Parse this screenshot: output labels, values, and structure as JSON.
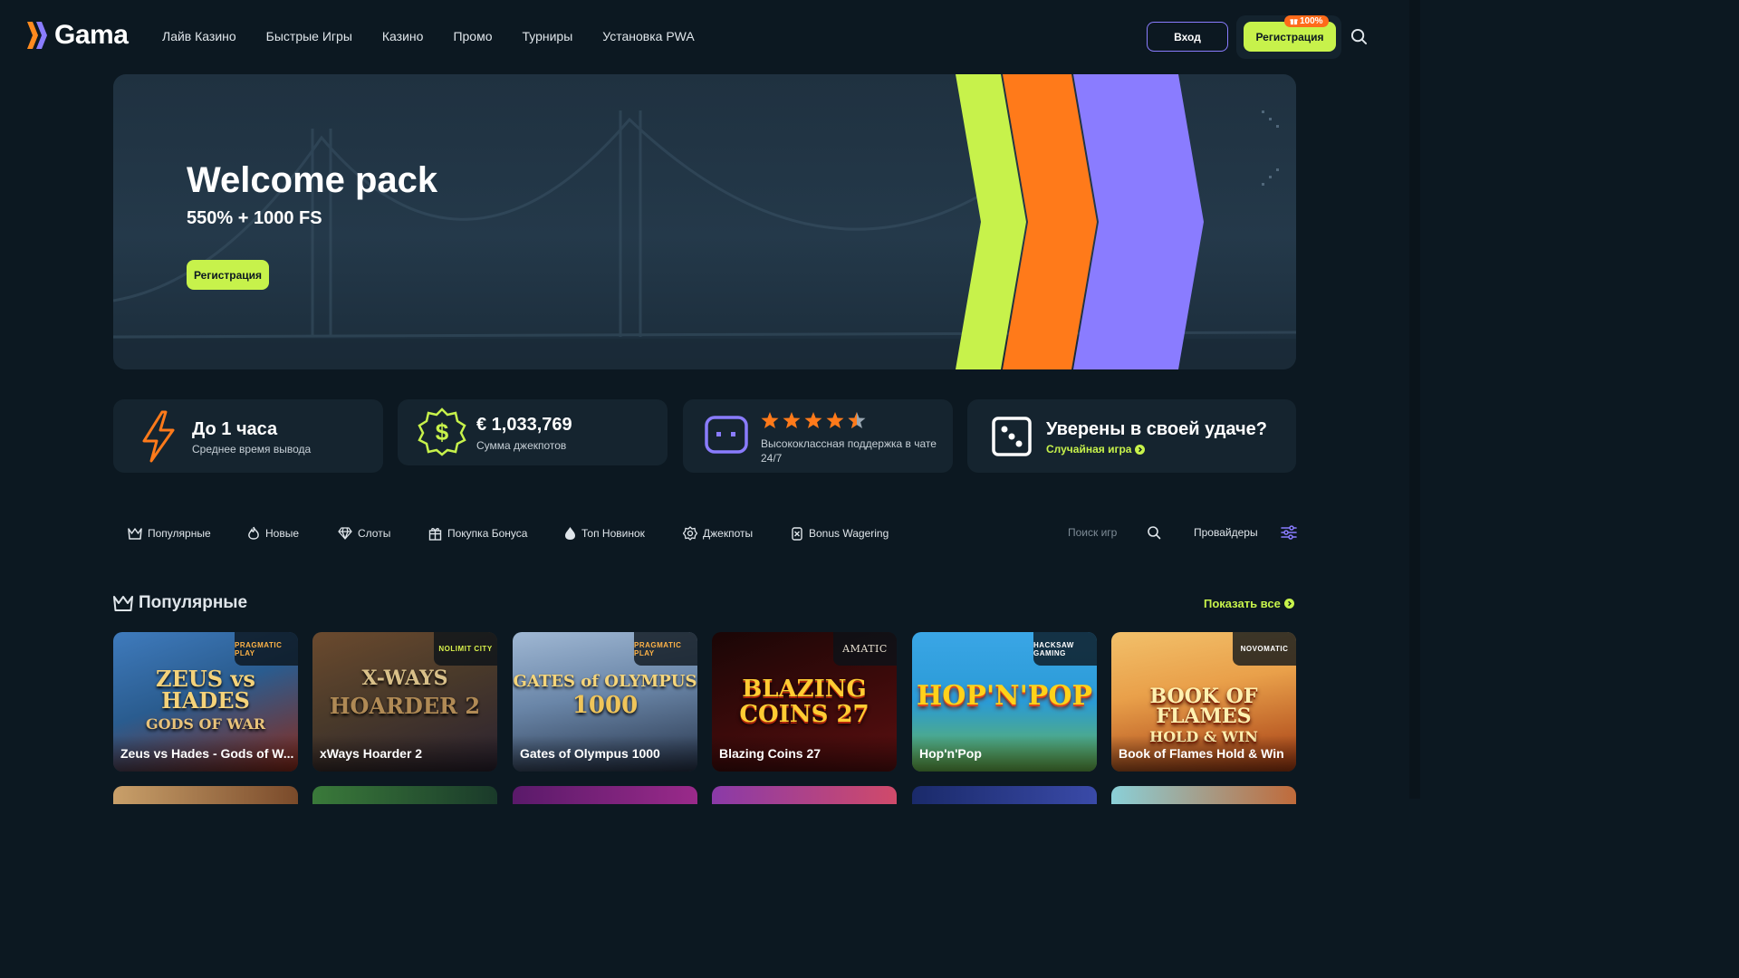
{
  "header": {
    "logo_text": "Gama",
    "nav": [
      "Лайв Казино",
      "Быстрые Игры",
      "Казино",
      "Промо",
      "Турниры",
      "Установка PWA"
    ],
    "login_label": "Вход",
    "register_label": "Регистрация",
    "register_badge": "100%"
  },
  "hero": {
    "title": "Welcome pack",
    "subtitle": "550% + 1000 FS",
    "button_label": "Регистрация"
  },
  "stats": {
    "payout": {
      "title": "До 1 часа",
      "subtitle": "Среднее время вывода"
    },
    "jackpot": {
      "title": "€ 1,033,769",
      "subtitle": "Сумма джекпотов"
    },
    "support": {
      "rating_stars": 4.5,
      "subtitle": "Высококлассная поддержка в чате 24/7"
    },
    "luck": {
      "title": "Уверены в своей удаче?",
      "link": "Случайная игра"
    }
  },
  "filters": [
    "Популярные",
    "Новые",
    "Слоты",
    "Покупка Бонуса",
    "Топ Новинок",
    "Джекпоты",
    "Bonus Wagering"
  ],
  "search": {
    "placeholder": "Поиск игр"
  },
  "providers_label": "Провайдеры",
  "section": {
    "title": "Популярные",
    "show_all": "Показать все",
    "games": [
      {
        "name": "Zeus vs Hades - Gods of W...",
        "provider": "PRAGMATIC PLAY",
        "art": "ZEUS vs HADES",
        "art2": "GODS OF WAR",
        "colors": [
          "#2a5c8f",
          "#8b2a1a"
        ]
      },
      {
        "name": "xWays Hoarder 2",
        "provider": "NOLIMIT CITY",
        "art": "X-WAYS",
        "art2": "HOARDER 2",
        "colors": [
          "#4a3a2a",
          "#2b2230"
        ]
      },
      {
        "name": "Gates of Olympus 1000",
        "provider": "PRAGMATIC PLAY",
        "art": "GATES of OLYMPUS",
        "art2": "1000",
        "colors": [
          "#6a86a8",
          "#27344a"
        ]
      },
      {
        "name": "Blazing Coins 27",
        "provider": "AMATIC",
        "art": "BLAZING",
        "art2": "COINS 27",
        "colors": [
          "#2a0a0a",
          "#5a0f10"
        ]
      },
      {
        "name": "Hop'n'Pop",
        "provider": "HACKSAW GAMING",
        "art": "HOP'N'POP",
        "art2": "",
        "colors": [
          "#2a9ad6",
          "#6bb84c"
        ]
      },
      {
        "name": "Book of Flames Hold & Win",
        "provider": "NOVOMATIC",
        "art": "BOOK OF FLAMES",
        "art2": "HOLD & WIN",
        "colors": [
          "#e9a04a",
          "#a33a12"
        ]
      }
    ]
  },
  "colors": {
    "background": "#0c1821",
    "card": "#15242f",
    "accent_lime": "#c7f24b",
    "accent_orange": "#ff7a1a",
    "accent_purple": "#8a7cff"
  }
}
